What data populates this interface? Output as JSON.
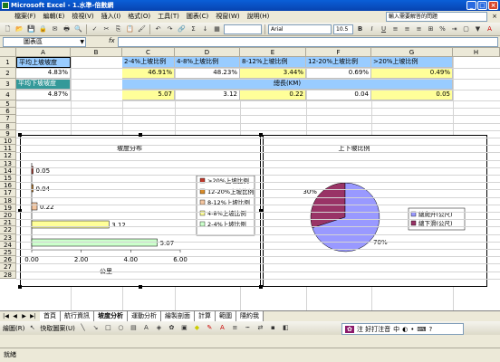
{
  "window": {
    "title": "Microsoft Excel - 1.水準-倍數網"
  },
  "menu": [
    "檔案(F)",
    "編輯(E)",
    "檢視(V)",
    "插入(I)",
    "格式(O)",
    "工具(T)",
    "圖表(C)",
    "視窗(W)",
    "說明(H)"
  ],
  "help_placeholder": "輸入需要解答的問題",
  "toolbar": {
    "font": "Arial",
    "size": "10.5",
    "bold": "B",
    "italic": "I",
    "underline": "U"
  },
  "formula_bar": {
    "name_box": "圖表區",
    "fx": "fx"
  },
  "columns": [
    "A",
    "B",
    "C",
    "D",
    "E",
    "F",
    "G",
    "H"
  ],
  "rows": [
    "1",
    "2",
    "3",
    "4",
    "5",
    "6",
    "7",
    "8",
    "9",
    "10",
    "11",
    "12",
    "13",
    "14",
    "15",
    "16",
    "17",
    "18",
    "19",
    "20",
    "21",
    "22",
    "23",
    "24",
    "25",
    "26",
    "27",
    "28"
  ],
  "cells": {
    "a1": "平均上坡坡度",
    "a2": "4.83%",
    "a3": "平均下坡坡度",
    "a4": "4.87%",
    "c1": "2-4%上坡比例",
    "d1": "4-8%上坡比例",
    "e1": "8-12%上坡比例",
    "f1": "12-20%上坡比例",
    "g1": ">20%上坡比例",
    "c2": "46.91%",
    "d2": "48.23%",
    "e2": "3.44%",
    "f2": "0.69%",
    "g2": "0.49%",
    "e3": "總長(KM)",
    "c4": "5.07",
    "d4": "3.12",
    "e4": "0.22",
    "f4": "0.04",
    "g4": "0.05"
  },
  "chart_data": [
    {
      "type": "bar",
      "title": "坡度分布",
      "xlabel": "公里",
      "orientation": "horizontal",
      "categories": [
        ">20%上坡比例",
        "12-20%上坡比例",
        "8-12%上坡比例",
        "4-8%上坡比例",
        "2-4%上坡比例"
      ],
      "values": [
        0.05,
        0.04,
        0.22,
        3.12,
        5.07
      ],
      "value_labels": [
        "0.05",
        "0.04",
        "0.22",
        "3.12",
        "5.07"
      ],
      "colors": [
        "#c0392b",
        "#d98c2b",
        "#f4c6a0",
        "#ffff99",
        "#ccffcc"
      ],
      "xlim": [
        0,
        6
      ],
      "xticks": [
        "0.00",
        "2.00",
        "4.00",
        "6.00"
      ],
      "legend": "right"
    },
    {
      "type": "pie",
      "title": "上下坡比例",
      "categories": [
        "總爬升(公尺)",
        "總下滑(公尺)"
      ],
      "values": [
        70,
        30
      ],
      "labels": [
        "70%",
        "30%"
      ],
      "colors": [
        "#9999ff",
        "#993366"
      ],
      "legend": "right"
    }
  ],
  "tabs": [
    "首頁",
    "航行資訊",
    "坡度分析",
    "運動分析",
    "繪製剖面",
    "計算",
    "範圍",
    "隱約我"
  ],
  "active_tab": "坡度分析",
  "drawbar": {
    "draw": "繪圖(R)",
    "autoshapes": "快取圖案(U)"
  },
  "ime": {
    "text": "注 好打注音",
    "lang": "中"
  },
  "status": "就緒"
}
